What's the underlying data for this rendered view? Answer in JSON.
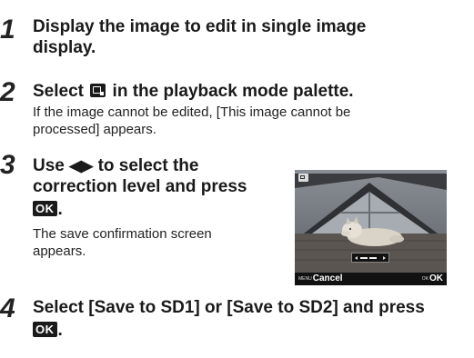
{
  "steps": [
    {
      "number": "1",
      "heading_line1": "Display the image to edit in single image",
      "heading_line2": "display."
    },
    {
      "number": "2",
      "heading_pre": "Select",
      "heading_icon": "image-edit-palette-icon",
      "heading_post": "in the playback mode palette.",
      "body_line1": "If the image cannot be edited, [This image cannot be",
      "body_line2": "processed] appears."
    },
    {
      "number": "3",
      "heading_line1_pre": "Use",
      "heading_arrows": "◀▶",
      "heading_line1_post": "to select the",
      "heading_line2": "correction level and press",
      "heading_ok": "OK",
      "heading_end": ".",
      "body_line1": "The save confirmation screen",
      "body_line2": "appears."
    },
    {
      "number": "4",
      "heading_line1": "Select [Save to SD1] or [Save to SD2] and press",
      "heading_ok": "OK",
      "heading_end": "."
    }
  ],
  "camera_screen": {
    "top_left_icon": "image-edit-icon",
    "menu_tag": "MENU",
    "cancel_label": "Cancel",
    "ok_tag": "OK",
    "ok_label": "OK",
    "level_indicator": "correction-level-slider"
  }
}
